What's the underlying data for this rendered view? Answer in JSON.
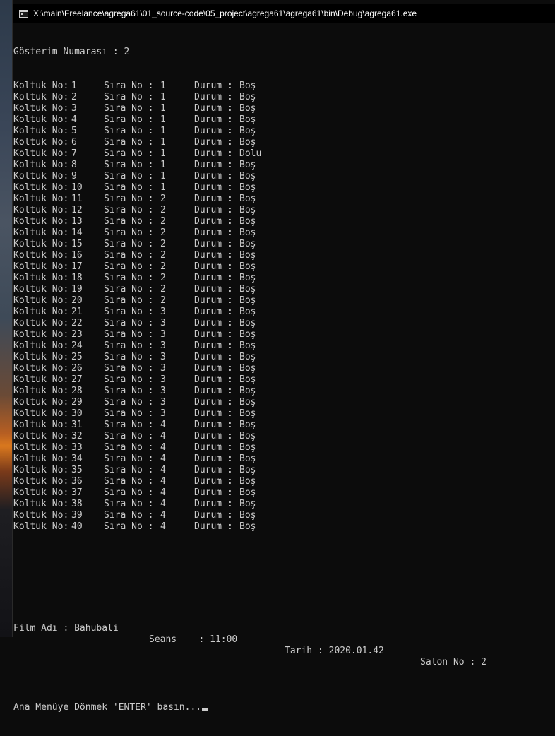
{
  "window": {
    "title": "X:\\main\\Freelance\\agrega61\\01_source-code\\05_project\\agrega61\\agrega61\\bin\\Debug\\agrega61.exe"
  },
  "console": {
    "heading": "Gösterim Numarası : 2",
    "seat_label": "Koltuk No:",
    "row_label": "Sıra No :",
    "status_label": "Durum :",
    "seats": [
      {
        "no": "1",
        "row": "1",
        "status": "Boş"
      },
      {
        "no": "2",
        "row": "1",
        "status": "Boş"
      },
      {
        "no": "3",
        "row": "1",
        "status": "Boş"
      },
      {
        "no": "4",
        "row": "1",
        "status": "Boş"
      },
      {
        "no": "5",
        "row": "1",
        "status": "Boş"
      },
      {
        "no": "6",
        "row": "1",
        "status": "Boş"
      },
      {
        "no": "7",
        "row": "1",
        "status": "Dolu"
      },
      {
        "no": "8",
        "row": "1",
        "status": "Boş"
      },
      {
        "no": "9",
        "row": "1",
        "status": "Boş"
      },
      {
        "no": "10",
        "row": "1",
        "status": "Boş"
      },
      {
        "no": "11",
        "row": "2",
        "status": "Boş"
      },
      {
        "no": "12",
        "row": "2",
        "status": "Boş"
      },
      {
        "no": "13",
        "row": "2",
        "status": "Boş"
      },
      {
        "no": "14",
        "row": "2",
        "status": "Boş"
      },
      {
        "no": "15",
        "row": "2",
        "status": "Boş"
      },
      {
        "no": "16",
        "row": "2",
        "status": "Boş"
      },
      {
        "no": "17",
        "row": "2",
        "status": "Boş"
      },
      {
        "no": "18",
        "row": "2",
        "status": "Boş"
      },
      {
        "no": "19",
        "row": "2",
        "status": "Boş"
      },
      {
        "no": "20",
        "row": "2",
        "status": "Boş"
      },
      {
        "no": "21",
        "row": "3",
        "status": "Boş"
      },
      {
        "no": "22",
        "row": "3",
        "status": "Boş"
      },
      {
        "no": "23",
        "row": "3",
        "status": "Boş"
      },
      {
        "no": "24",
        "row": "3",
        "status": "Boş"
      },
      {
        "no": "25",
        "row": "3",
        "status": "Boş"
      },
      {
        "no": "26",
        "row": "3",
        "status": "Boş"
      },
      {
        "no": "27",
        "row": "3",
        "status": "Boş"
      },
      {
        "no": "28",
        "row": "3",
        "status": "Boş"
      },
      {
        "no": "29",
        "row": "3",
        "status": "Boş"
      },
      {
        "no": "30",
        "row": "3",
        "status": "Boş"
      },
      {
        "no": "31",
        "row": "4",
        "status": "Boş"
      },
      {
        "no": "32",
        "row": "4",
        "status": "Boş"
      },
      {
        "no": "33",
        "row": "4",
        "status": "Boş"
      },
      {
        "no": "34",
        "row": "4",
        "status": "Boş"
      },
      {
        "no": "35",
        "row": "4",
        "status": "Boş"
      },
      {
        "no": "36",
        "row": "4",
        "status": "Boş"
      },
      {
        "no": "37",
        "row": "4",
        "status": "Boş"
      },
      {
        "no": "38",
        "row": "4",
        "status": "Boş"
      },
      {
        "no": "39",
        "row": "4",
        "status": "Boş"
      },
      {
        "no": "40",
        "row": "4",
        "status": "Boş"
      }
    ],
    "info": {
      "film": "Film Adı : Bahubali",
      "session": "Seans    : 11:00",
      "date": "Tarih : 2020.01.42",
      "hall": "Salon No : 2"
    },
    "prompt": "Ana Menüye Dönmek 'ENTER' basın..."
  }
}
